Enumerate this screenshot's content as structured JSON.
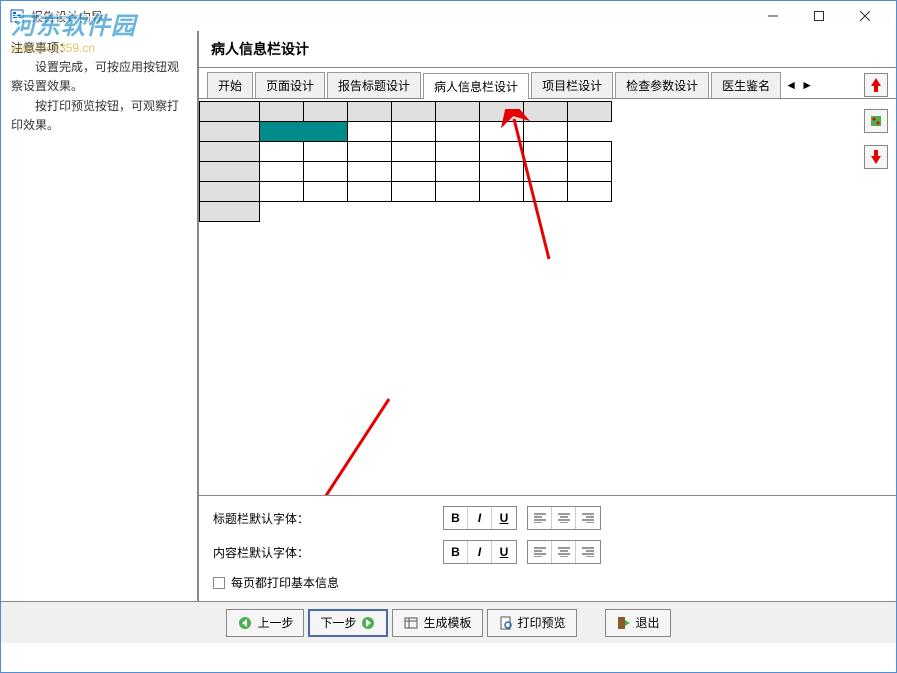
{
  "titlebar": {
    "title": "报告设计向导"
  },
  "sidebar": {
    "text_line1": "注意事项：",
    "text_line2": "　　设置完成，可按应用按钮观察设置效果。",
    "text_line3": "　　按打印预览按钮，可观察打印效果。"
  },
  "section": {
    "title": "病人信息栏设计"
  },
  "tabs": [
    {
      "label": "开始",
      "active": false
    },
    {
      "label": "页面设计",
      "active": false
    },
    {
      "label": "报告标题设计",
      "active": false
    },
    {
      "label": "病人信息栏设计",
      "active": true
    },
    {
      "label": "项目栏设计",
      "active": false
    },
    {
      "label": "检查参数设计",
      "active": false
    },
    {
      "label": "医生鉴名",
      "active": false
    }
  ],
  "fontSettings": {
    "titleFont": "标题栏默认字体：",
    "contentFont": "内容栏默认字体：",
    "checkbox": "每页都打印基本信息"
  },
  "formatButtons": {
    "bold": "B",
    "italic": "I",
    "underline": "U"
  },
  "bottomButtons": {
    "prev": "上一步",
    "next": "下一步",
    "genTemplate": "生成模板",
    "printPreview": "打印预览",
    "exit": "退出"
  },
  "watermark": {
    "main": "河东软件园",
    "sub": "www.pc0359.cn"
  }
}
